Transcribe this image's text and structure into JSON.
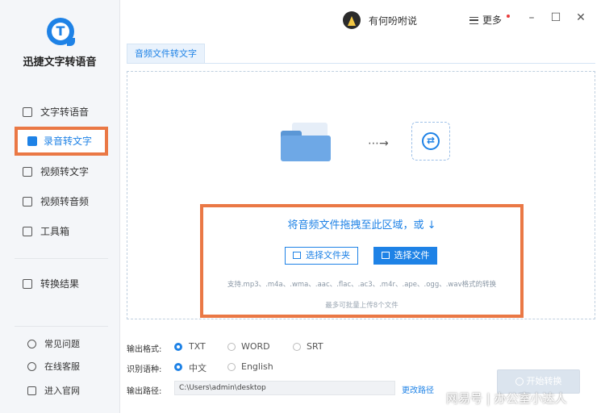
{
  "app": {
    "name": "迅捷文字转语音"
  },
  "sidebar": {
    "items": [
      {
        "label": "文字转语音",
        "icon": "text-to-speech-icon"
      },
      {
        "label": "录音转文字",
        "icon": "recording-to-text-icon",
        "active": true
      },
      {
        "label": "视频转文字",
        "icon": "video-to-text-icon"
      },
      {
        "label": "视频转音频",
        "icon": "video-to-audio-icon"
      },
      {
        "label": "工具箱",
        "icon": "toolbox-icon"
      },
      {
        "label": "转换结果",
        "icon": "results-icon"
      }
    ],
    "footer": [
      {
        "label": "常见问题",
        "icon": "help-icon"
      },
      {
        "label": "在线客服",
        "icon": "headset-icon"
      },
      {
        "label": "进入官网",
        "icon": "monitor-icon"
      }
    ]
  },
  "topbar": {
    "username": "有何吩咐说",
    "more_label": "更多",
    "window_controls": [
      "minimize-icon",
      "maximize-icon",
      "close-icon"
    ]
  },
  "tab": {
    "label": "音频文件转文字"
  },
  "dropzone": {
    "instruction": "将音频文件拖拽至此区域，或 ↓",
    "select_folder_label": "选择文件夹",
    "select_file_label": "选择文件",
    "formats_text": "支持.mp3、.m4a、.wma、.aac、.flac、.ac3、.m4r、.ape、.ogg、.wav格式的转换",
    "max_files_text": "最多可批量上传8个文件"
  },
  "settings": {
    "output_format": {
      "label": "输出格式:",
      "options": [
        "TXT",
        "WORD",
        "SRT"
      ],
      "selected": "TXT"
    },
    "language": {
      "label": "识别语种:",
      "options": [
        "中文",
        "English"
      ],
      "selected": "中文"
    },
    "output_path": {
      "label": "输出路径:",
      "value": "C:\\Users\\admin\\desktop",
      "change_label": "更改路径"
    }
  },
  "start_button": {
    "label": "开始转换"
  },
  "watermark": {
    "text": "网易号 | 办公室小达人"
  },
  "colors": {
    "accent": "#1e82e6",
    "highlight": "#ea7845",
    "sidebar_bg": "#f4f6f9"
  }
}
